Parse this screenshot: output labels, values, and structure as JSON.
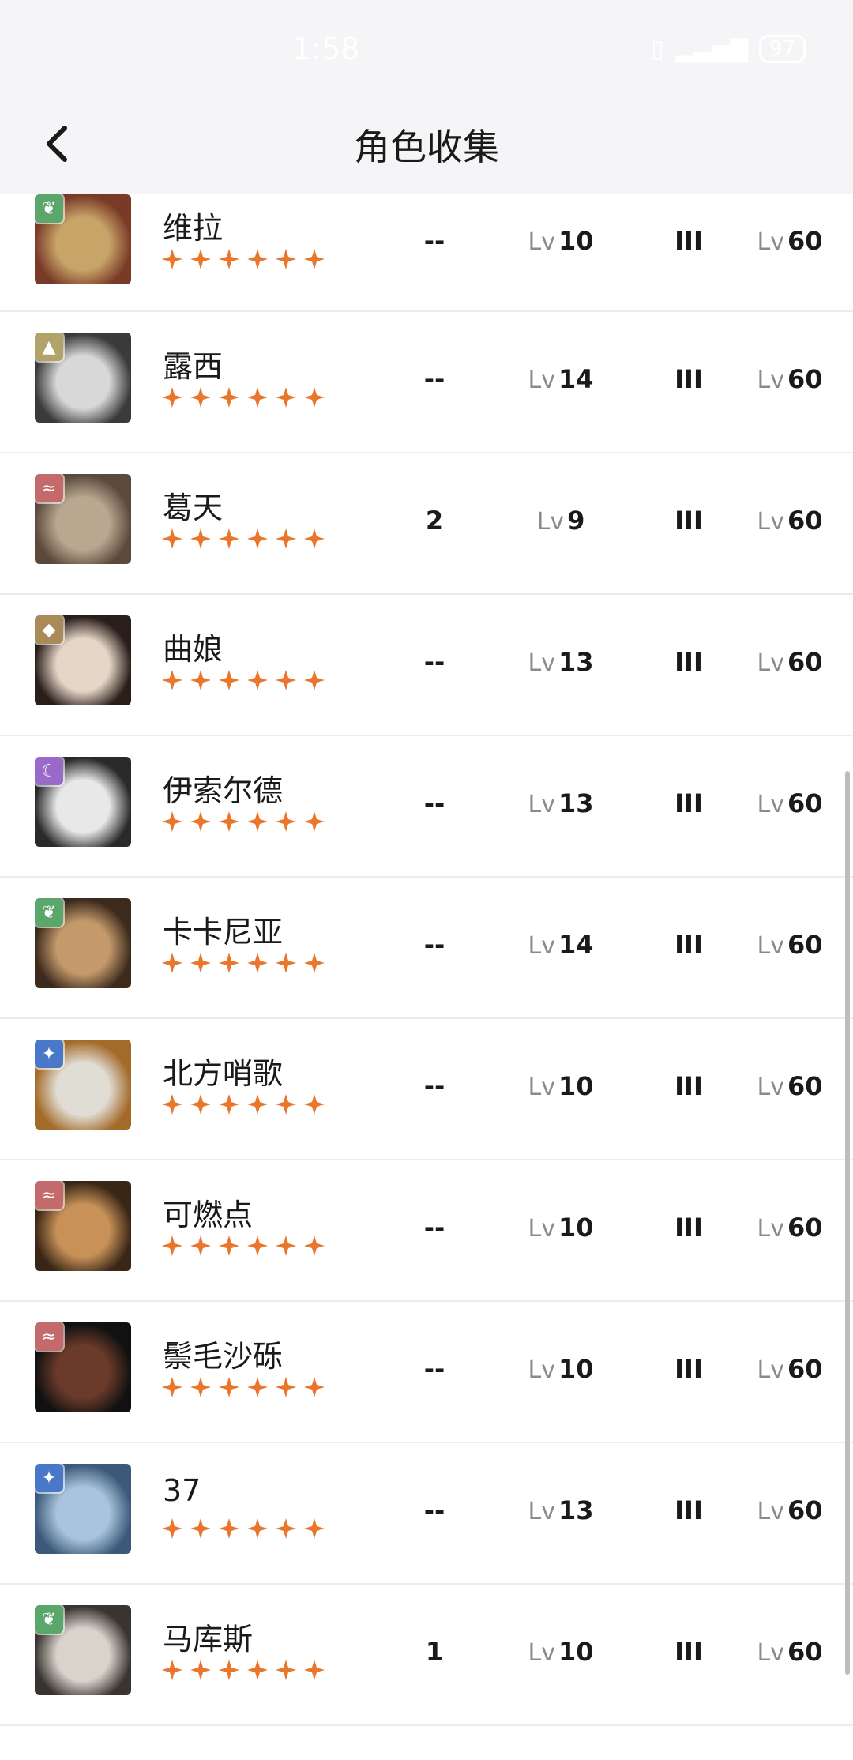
{
  "status": {
    "time": "1:58",
    "battery": "97"
  },
  "header": {
    "title": "角色收集"
  },
  "colors": {
    "star": "#e9762b",
    "header_bg": "#f5f5f7"
  },
  "characters": [
    {
      "name": "维拉",
      "element": "leaf",
      "element_color": "#5aa66b",
      "stars": 6,
      "dupes": "--",
      "level_prefix": "Lv",
      "level": "10",
      "rank": "III",
      "max_prefix": "Lv",
      "max": "60",
      "palette": [
        "#c8a468",
        "#7a3a28"
      ]
    },
    {
      "name": "露西",
      "element": "mountain",
      "element_color": "#b1a36a",
      "stars": 6,
      "dupes": "--",
      "level_prefix": "Lv",
      "level": "14",
      "rank": "III",
      "max_prefix": "Lv",
      "max": "60",
      "palette": [
        "#d8d8d8",
        "#3a3a3a"
      ]
    },
    {
      "name": "葛天",
      "element": "fire",
      "element_color": "#c46a6a",
      "stars": 6,
      "dupes": "2",
      "level_prefix": "Lv",
      "level": "9",
      "rank": "III",
      "max_prefix": "Lv",
      "max": "60",
      "palette": [
        "#b8a890",
        "#5b4a3c"
      ]
    },
    {
      "name": "曲娘",
      "element": "earth",
      "element_color": "#a98a58",
      "stars": 6,
      "dupes": "--",
      "level_prefix": "Lv",
      "level": "13",
      "rank": "III",
      "max_prefix": "Lv",
      "max": "60",
      "palette": [
        "#e6d6c8",
        "#2a1e1a"
      ]
    },
    {
      "name": "伊索尔德",
      "element": "moon",
      "element_color": "#9a6acb",
      "stars": 6,
      "dupes": "--",
      "level_prefix": "Lv",
      "level": "13",
      "rank": "III",
      "max_prefix": "Lv",
      "max": "60",
      "palette": [
        "#e8e8e8",
        "#2a2a2a"
      ]
    },
    {
      "name": "卡卡尼亚",
      "element": "leaf",
      "element_color": "#5aa66b",
      "stars": 6,
      "dupes": "--",
      "level_prefix": "Lv",
      "level": "14",
      "rank": "III",
      "max_prefix": "Lv",
      "max": "60",
      "palette": [
        "#c49a6c",
        "#3c2a1c"
      ]
    },
    {
      "name": "北方哨歌",
      "element": "star",
      "element_color": "#4a78c8",
      "stars": 6,
      "dupes": "--",
      "level_prefix": "Lv",
      "level": "10",
      "rank": "III",
      "max_prefix": "Lv",
      "max": "60",
      "palette": [
        "#e0ddd4",
        "#a46a2a"
      ]
    },
    {
      "name": "可燃点",
      "element": "fire",
      "element_color": "#c46a6a",
      "stars": 6,
      "dupes": "--",
      "level_prefix": "Lv",
      "level": "10",
      "rank": "III",
      "max_prefix": "Lv",
      "max": "60",
      "palette": [
        "#c79158",
        "#3a2616"
      ]
    },
    {
      "name": "鬃毛沙砾",
      "element": "fire",
      "element_color": "#c46a6a",
      "stars": 6,
      "dupes": "--",
      "level_prefix": "Lv",
      "level": "10",
      "rank": "III",
      "max_prefix": "Lv",
      "max": "60",
      "palette": [
        "#6a3a2a",
        "#111111"
      ]
    },
    {
      "name": "37",
      "element": "star",
      "element_color": "#4a78c8",
      "stars": 6,
      "dupes": "--",
      "level_prefix": "Lv",
      "level": "13",
      "rank": "III",
      "max_prefix": "Lv",
      "max": "60",
      "palette": [
        "#a9c4dc",
        "#3b5a7a"
      ]
    },
    {
      "name": "马库斯",
      "element": "leaf",
      "element_color": "#5aa66b",
      "stars": 6,
      "dupes": "1",
      "level_prefix": "Lv",
      "level": "10",
      "rank": "III",
      "max_prefix": "Lv",
      "max": "60",
      "palette": [
        "#d8d4cc",
        "#3a3430"
      ]
    }
  ]
}
